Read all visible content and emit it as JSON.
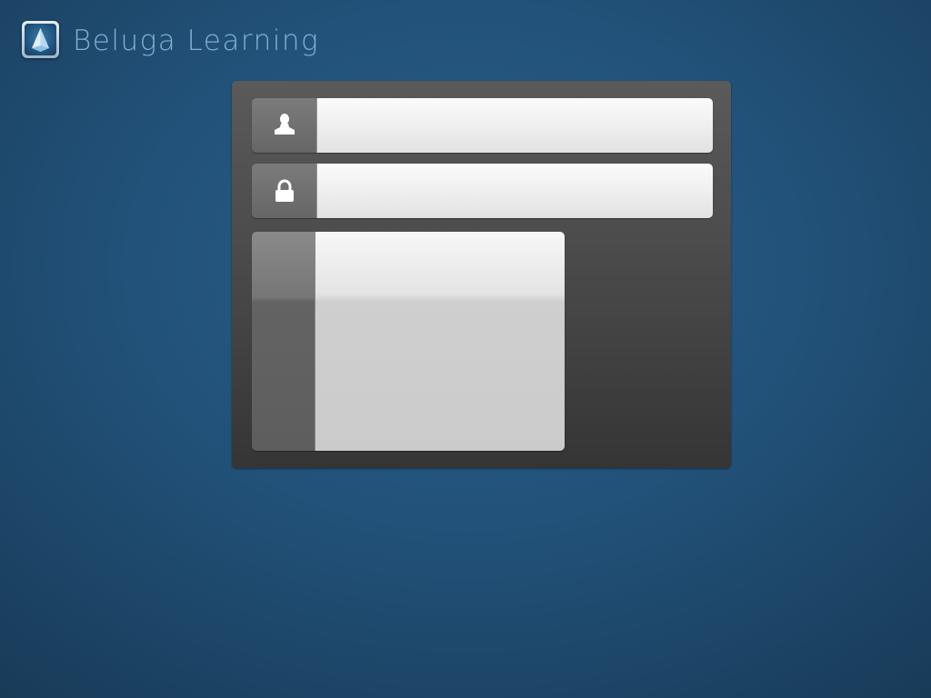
{
  "app": {
    "title": "Beluga Learning",
    "logo_icon": "beluga-logo-icon"
  },
  "login": {
    "username": {
      "icon": "user-icon",
      "value": "",
      "placeholder": ""
    },
    "password": {
      "icon": "lock-icon",
      "value": "",
      "placeholder": ""
    },
    "submit_label": ""
  },
  "colors": {
    "background": "#22527a",
    "panel": "#474747",
    "title_text": "#7fb1d3",
    "field": "#efefef",
    "icon_box": "#6e6e6e"
  }
}
